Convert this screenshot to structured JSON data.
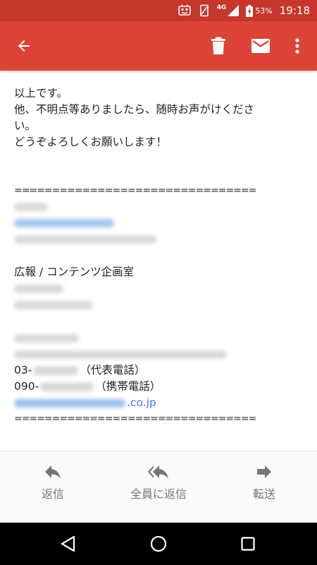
{
  "status_bar": {
    "network": "4G",
    "battery": "53%",
    "time": "19:18"
  },
  "app_bar": {
    "back_icon": "arrow-left-icon",
    "delete_icon": "trash-icon",
    "mail_icon": "envelope-icon",
    "more_icon": "more-vert-icon"
  },
  "message": {
    "line1": "以上です。",
    "line2": "他、不明点等ありましたら、随時お声がけくださ",
    "line3": "い。",
    "line4": "どうぞよろしくお願いします！",
    "rule_top": "================================",
    "signature_department": "広報 / コンテンツ企画室",
    "phone_office_prefix": "03-",
    "phone_office_suffix": "（代表電話）",
    "phone_mobile_prefix": "090-",
    "phone_mobile_suffix": "（携帯電話）",
    "email_domain": ".co.jp",
    "rule_bottom": "================================"
  },
  "actions": {
    "reply": "返信",
    "reply_all": "全員に返信",
    "forward": "転送"
  },
  "colors": {
    "app_bar": "#db4437",
    "status_bar": "#c5362b",
    "link": "#3b78e7"
  }
}
